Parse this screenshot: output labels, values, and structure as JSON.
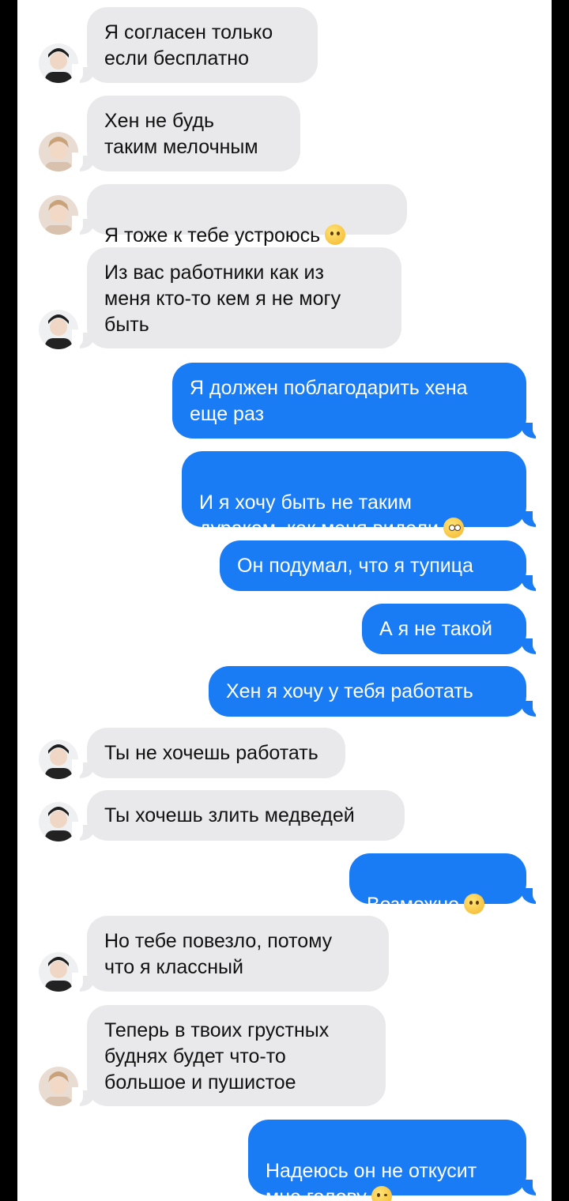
{
  "messages": [
    {
      "side": "in",
      "avatar": "dark",
      "text": "Я согласен только\nесли бесплатно"
    },
    {
      "side": "in",
      "avatar": "light",
      "text": "Хен не будь\nтаким мелочным"
    },
    {
      "side": "in",
      "avatar": "light",
      "text": "Я тоже к тебе устроюсь",
      "emoji": "hand-over-mouth-emoji"
    },
    {
      "side": "in",
      "avatar": "dark",
      "text": "Из вас работники как из\nменя кто-то кем я не могу\nбыть"
    },
    {
      "side": "out",
      "text": "Я должен поблагодарить хена\nеще раз"
    },
    {
      "side": "out",
      "text": "И я хочу быть не таким\nдураком, как меня видели",
      "emoji": "pleading-face-emoji"
    },
    {
      "side": "out",
      "text": "Он подумал, что я тупица"
    },
    {
      "side": "out",
      "text": "А я не такой"
    },
    {
      "side": "out",
      "text": "Хен я хочу у тебя работать"
    },
    {
      "side": "in",
      "avatar": "dark",
      "text": "Ты не хочешь работать"
    },
    {
      "side": "in",
      "avatar": "dark",
      "text": "Ты хочешь злить медведей"
    },
    {
      "side": "out",
      "text": "Возможно",
      "emoji": "frowning-face-emoji"
    },
    {
      "side": "in",
      "avatar": "dark",
      "text": "Но тебе повезло, потому\nчто я классный"
    },
    {
      "side": "in",
      "avatar": "light",
      "text": "Теперь в твоих грустных\nбуднях будет что-то\nбольшое и пушистое"
    },
    {
      "side": "out",
      "text": "Надеюсь он не откусит\nмне голову",
      "emoji": "woozy-face-emoji"
    }
  ],
  "colors": {
    "incoming_bubble": "#e9e9eb",
    "outgoing_bubble": "#1a7cf5"
  }
}
